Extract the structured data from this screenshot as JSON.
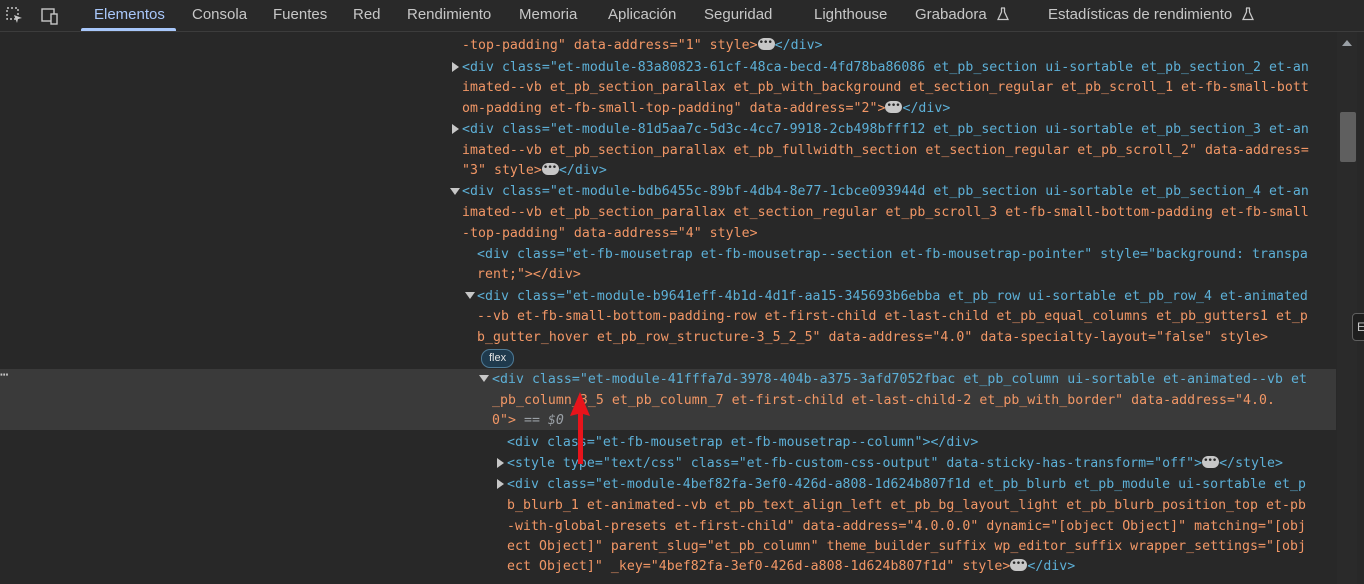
{
  "tabs": [
    {
      "label": "Elementos",
      "active": true
    },
    {
      "label": "Consola"
    },
    {
      "label": "Fuentes"
    },
    {
      "label": "Red"
    },
    {
      "label": "Rendimiento"
    },
    {
      "label": "Memoria"
    },
    {
      "label": "Aplicación"
    },
    {
      "label": "Seguridad"
    },
    {
      "label": "Lighthouse"
    },
    {
      "label": "Grabadora"
    },
    {
      "label": "Estadísticas de rendimiento"
    }
  ],
  "icons": {
    "inspect": "select-element-icon",
    "device": "device-toolbar-icon",
    "flask": "experimental-flask-icon",
    "ellipsis": "ellipsis-icon",
    "arrow": "red-arrow-annotation-icon"
  },
  "colors": {
    "accent": "#a8c7fa",
    "arrow": "#e8141b",
    "tag": "#5db0d7",
    "attr_value": "#f29766"
  },
  "left_dots": "⋯",
  "badge": "flex",
  "dom": {
    "l0": "-top-padding\" data-address=\"1\" style>",
    "l0_close": "</div>",
    "n2_a": "<div class=\"et-module-83a80823-61cf-48ca-becd-4fd78ba86086 et_pb_section ui-sortable et_pb_section_2 et-an",
    "n2_b": "imated--vb et_pb_section_parallax et_pb_with_background et_section_regular et_pb_scroll_1 et-fb-small-bott",
    "n2_c": "om-padding et-fb-small-top-padding\" data-address=\"2\">",
    "n3_a": "<div class=\"et-module-81d5aa7c-5d3c-4cc7-9918-2cb498bfff12 et_pb_section ui-sortable et_pb_section_3 et-an",
    "n3_b": "imated--vb et_pb_section_parallax et_pb_fullwidth_section et_section_regular et_pb_scroll_2\" data-address=",
    "n3_c": "\"3\" style>",
    "n4_a": "<div class=\"et-module-bdb6455c-89bf-4db4-8e77-1cbce093944d et_pb_section ui-sortable et_pb_section_4 et-an",
    "n4_b": "imated--vb et_pb_section_parallax et_section_regular et_pb_scroll_3 et-fb-small-bottom-padding et-fb-small",
    "n4_c": "-top-padding\" data-address=\"4\" style>",
    "mt_a": "<div class=\"et-fb-mousetrap et-fb-mousetrap--section et-fb-mousetrap-pointer\" style=\"background: transpa",
    "mt_b": "rent;\"></div>",
    "row_a": "<div class=\"et-module-b9641eff-4b1d-4d1f-aa15-345693b6ebba et_pb_row ui-sortable et_pb_row_4 et-animated",
    "row_b": "--vb et-fb-small-bottom-padding-row et-first-child et-last-child et_pb_equal_columns et_pb_gutters1 et_p",
    "row_c": "b_gutter_hover et_pb_row_structure-3_5_2_5\" data-address=\"4.0\" data-specialty-layout=\"false\" style>",
    "col_a": "<div class=\"et-module-41fffa7d-3978-404b-a375-3afd7052fbac et_pb_column ui-sortable et-animated--vb et",
    "col_b": "_pb_column_3_5 et_pb_column_7 et-first-child et-last-child-2 et_pb_with_border\" data-address=\"4.0.",
    "col_c": "0\">",
    "col_eq": " == $0",
    "mt2": "<div class=\"et-fb-mousetrap et-fb-mousetrap--column\"></div>",
    "style": "<style type=\"text/css\" class=\"et-fb-custom-css-output\" data-sticky-has-transform=\"off\">",
    "style_close": "</style>",
    "bl_a": "<div class=\"et-module-4bef82fa-3ef0-426d-a808-1d624b807f1d et_pb_blurb et_pb_module ui-sortable et_p",
    "bl_b": "b_blurb_1 et-animated--vb et_pb_text_align_left et_pb_bg_layout_light et_pb_blurb_position_top et-pb",
    "bl_c": "-with-global-presets et-first-child\" data-address=\"4.0.0.0\" dynamic=\"[object Object]\" matching=\"[obj",
    "bl_d": "ect Object]\" parent_slug=\"et_pb_column\" theme_builder_suffix wp_editor_suffix wrapper_settings=\"[obj",
    "bl_e": "ect Object]\" _key=\"4bef82fa-3ef0-426d-a808-1d624b807f1d\" style>",
    "bl_close": "</div>"
  }
}
